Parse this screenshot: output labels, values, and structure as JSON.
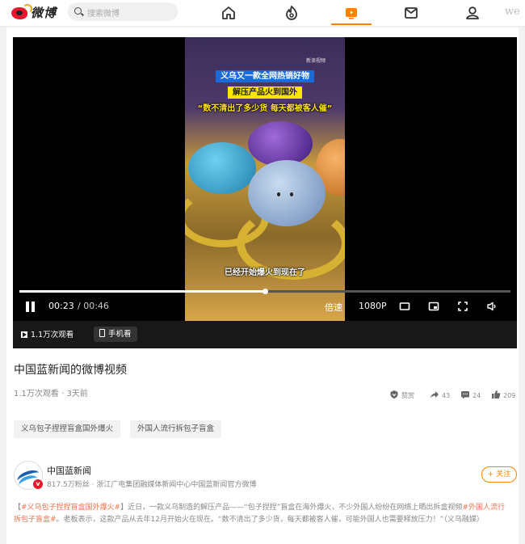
{
  "header": {
    "logo_text": "微博",
    "search_placeholder": "搜索微博",
    "nav_items": [
      "home-icon",
      "hot-icon",
      "video-icon",
      "message-icon",
      "profile-icon"
    ],
    "truncated_text": "we"
  },
  "player": {
    "watermark": "新浪视频",
    "captions": [
      "义乌又一款全网热销好物",
      "解压产品火到国外",
      "“数不清出了多少货 每天都被客人催”",
      "已经开始爆火到现在了"
    ],
    "current_time": "00:23",
    "total_time": " / 00:46",
    "progress": 0.5,
    "speed_label": "倍速",
    "quality_label": "1080P",
    "views_label": "1.1万次观看",
    "phone_label": "手机看"
  },
  "video": {
    "title": "中国蓝新闻的微博视频",
    "meta": "1.1万次观看 · 3天前",
    "actions": {
      "favorite_label": "赞赏",
      "share_count": "43",
      "comment_count": "24",
      "like_count": "209"
    },
    "tags": [
      "义乌包子捏捏盲盒国外爆火",
      "外国人流行拆包子盲盒"
    ]
  },
  "author": {
    "name": "中国蓝新闻",
    "description": "817.5万粉丝 · 浙江广电集团融媒体新闻中心中国蓝新闻官方微博",
    "follow_label": "+ 关注"
  },
  "description": {
    "prefix": "【",
    "topic1": "#义乌包子捏捏盲盒国外爆火#",
    "middle": "】近日，一款义乌制造的解压产品——“包子捏捏”盲盒在海外爆火，不少外国人纷纷在网络上晒出拆盒视频",
    "topic2": "#外国人流行拆包子盲盒#",
    "suffix": "。老板表示，这款产品从去年12月开始火在现在。“数不清出了多少货，每天都被客人催，可能外国人也需要释放压力！”（义乌融媒）"
  },
  "colors": {
    "accent": "#ff8200",
    "weibo_red": "#e6162d",
    "topic": "#eb7350"
  }
}
